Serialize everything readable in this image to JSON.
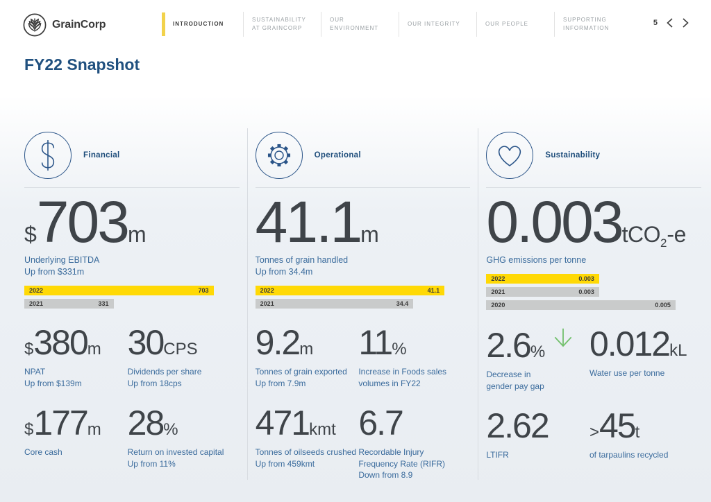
{
  "brand": {
    "name": "GrainCorp"
  },
  "nav": {
    "items": [
      {
        "label": "INTRODUCTION",
        "active": true
      },
      {
        "label": "SUSTAINABILITY AT GRAINCORP",
        "active": false
      },
      {
        "label": "OUR ENVIRONMENT",
        "active": false
      },
      {
        "label": "OUR INTEGRITY",
        "active": false
      },
      {
        "label": "OUR PEOPLE",
        "active": false
      },
      {
        "label": "SUPPORTING INFORMATION",
        "active": false
      }
    ],
    "page_number": "5"
  },
  "page": {
    "title": "FY22 Snapshot"
  },
  "colors": {
    "accent_yellow": "#FFD905",
    "bar_grey": "#C9CBCB",
    "heading_blue": "#1E4D7B",
    "label_blue": "#3A6B9C",
    "number_grey": "#3F4449",
    "arrow_green": "#72C06C"
  },
  "columns": [
    {
      "title": "Financial",
      "icon": "dollar-icon",
      "hero": {
        "prefix": "$",
        "value": "703",
        "suffix": "m",
        "labels": [
          "Underlying EBITDA",
          "Up from $331m"
        ]
      },
      "bars": [
        {
          "year": "2022",
          "value": "703",
          "width_pct": "88%"
        },
        {
          "year": "2021",
          "value": "331",
          "width_pct": "41.5%"
        }
      ],
      "stats": [
        {
          "prefix": "$",
          "value": "380",
          "suffix": "m",
          "labels": [
            "NPAT",
            "Up from $139m"
          ]
        },
        {
          "prefix": "",
          "value": "30",
          "suffix": "CPS",
          "labels": [
            "Dividends per share",
            "Up from 18cps"
          ]
        },
        {
          "prefix": "$",
          "value": "177",
          "suffix": "m",
          "labels": [
            "Core cash"
          ]
        },
        {
          "prefix": "",
          "value": "28",
          "suffix": "%",
          "labels": [
            "Return on invested capital",
            "Up from 11%"
          ]
        }
      ]
    },
    {
      "title": "Operational",
      "icon": "gear-icon",
      "hero": {
        "prefix": "",
        "value": "41.1",
        "suffix": "m",
        "labels": [
          "Tonnes of grain handled",
          "Up from 34.4m"
        ]
      },
      "bars": [
        {
          "year": "2022",
          "value": "41.1",
          "width_pct": "88%"
        },
        {
          "year": "2021",
          "value": "34.4",
          "width_pct": "73.5%"
        }
      ],
      "stats": [
        {
          "prefix": "",
          "value": "9.2",
          "suffix": "m",
          "labels": [
            "Tonnes of grain exported",
            "Up from 7.9m"
          ]
        },
        {
          "prefix": "",
          "value": "11",
          "suffix": "%",
          "labels": [
            "Increase in Foods sales",
            "volumes in FY22"
          ]
        },
        {
          "prefix": "",
          "value": "471",
          "suffix": "kmt",
          "labels": [
            "Tonnes of oilseeds crushed",
            "Up from 459kmt"
          ]
        },
        {
          "prefix": "",
          "value": "6.7",
          "suffix": "",
          "labels": [
            "Recordable Injury",
            "Frequency Rate (RIFR)",
            "Down from 8.9"
          ]
        }
      ]
    },
    {
      "title": "Sustainability",
      "icon": "heart-icon",
      "hero": {
        "prefix": "",
        "value": "0.003",
        "suffix": "tCO",
        "suffix_sub": "2",
        "suffix_tail": "-e",
        "labels": [
          "GHG emissions per tonne"
        ]
      },
      "bars": [
        {
          "year": "2022",
          "value": "0.003",
          "width_pct": "52.5%"
        },
        {
          "year": "2021",
          "value": "0.003",
          "width_pct": "52.5%"
        },
        {
          "year": "2020",
          "value": "0.005",
          "width_pct": "88%"
        }
      ],
      "stats": [
        {
          "prefix": "",
          "value": "2.6",
          "suffix": "%",
          "labels": [
            "Decrease in",
            "gender pay gap"
          ],
          "arrow": "green-down"
        },
        {
          "prefix": "",
          "value": "0.012",
          "suffix": "kL",
          "labels": [
            "Water use per tonne"
          ]
        },
        {
          "prefix": "",
          "value": "2.62",
          "suffix": "",
          "labels": [
            "LTIFR"
          ]
        },
        {
          "prefix": ">",
          "value": "45",
          "suffix": "t",
          "labels": [
            "of tarpaulins recycled"
          ]
        }
      ]
    }
  ],
  "chart_data": [
    {
      "type": "bar",
      "orientation": "horizontal",
      "title": "Underlying EBITDA ($m)",
      "categories": [
        "2022",
        "2021"
      ],
      "values": [
        703,
        331
      ],
      "highlight_category": "2022"
    },
    {
      "type": "bar",
      "orientation": "horizontal",
      "title": "Tonnes of grain handled (m)",
      "categories": [
        "2022",
        "2021"
      ],
      "values": [
        41.1,
        34.4
      ],
      "highlight_category": "2022"
    },
    {
      "type": "bar",
      "orientation": "horizontal",
      "title": "GHG emissions per tonne (tCO2-e)",
      "categories": [
        "2022",
        "2021",
        "2020"
      ],
      "values": [
        0.003,
        0.003,
        0.005
      ],
      "highlight_category": "2022"
    }
  ]
}
